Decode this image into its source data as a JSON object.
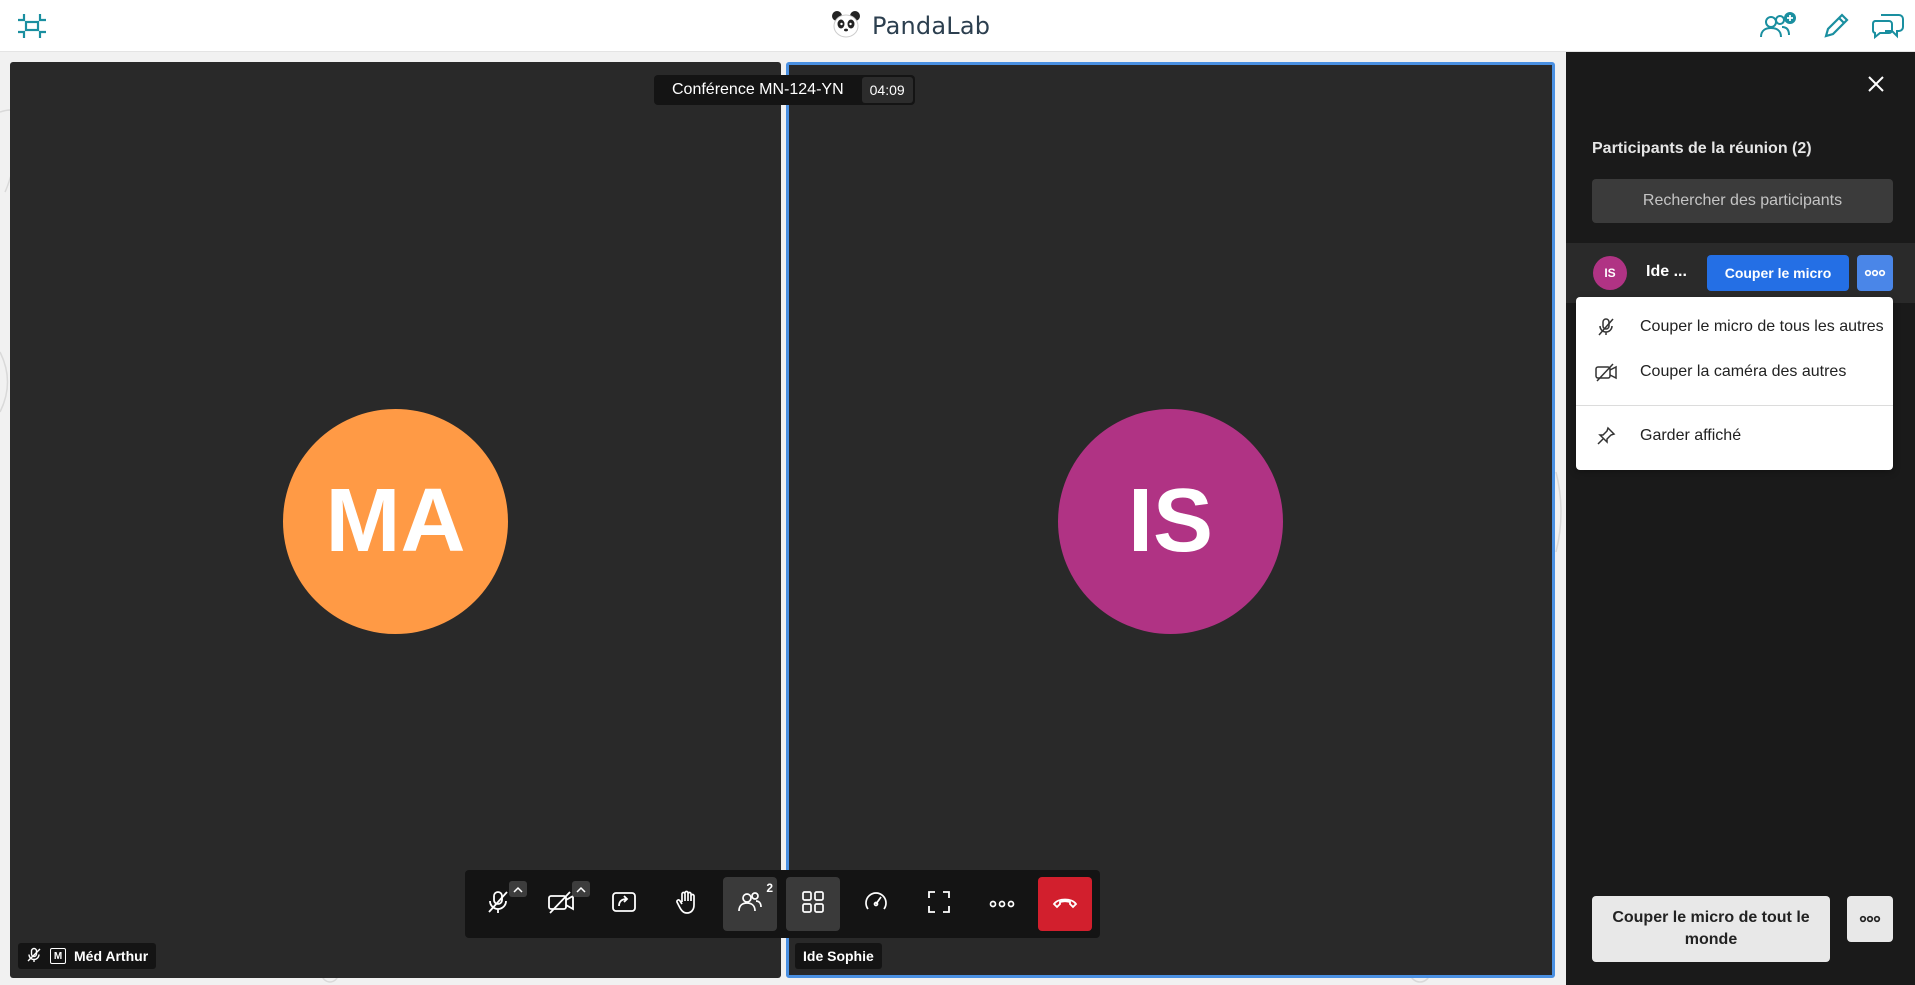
{
  "app": {
    "brand": "PandaLab"
  },
  "conference": {
    "name": "Conférence MN-124-YN",
    "timer": "04:09"
  },
  "tiles": [
    {
      "initials": "MA",
      "name": "Méd Arthur",
      "badge": "M",
      "color": "#ff9a45"
    },
    {
      "initials": "IS",
      "name": "Ide Sophie",
      "color": "#b03384"
    }
  ],
  "toolbar": {
    "participants_count": "2"
  },
  "panel": {
    "title": "Participants de la réunion (2)",
    "search_placeholder": "Rechercher des participants",
    "participant": {
      "initials": "IS",
      "name": "Ide ...",
      "mute_label": "Couper le micro"
    },
    "menu": [
      {
        "label": "Couper le micro de tous les autres",
        "icon": "mic-off-icon"
      },
      {
        "label": "Couper la caméra des autres",
        "icon": "camera-off-icon"
      },
      {
        "label": "Garder affiché",
        "icon": "pin-icon"
      }
    ],
    "mute_all_label": "Couper le micro de tout le monde"
  },
  "colors": {
    "accent": "#246fe5",
    "hangup": "#d21f2d",
    "teal": "#1a8fa0"
  }
}
